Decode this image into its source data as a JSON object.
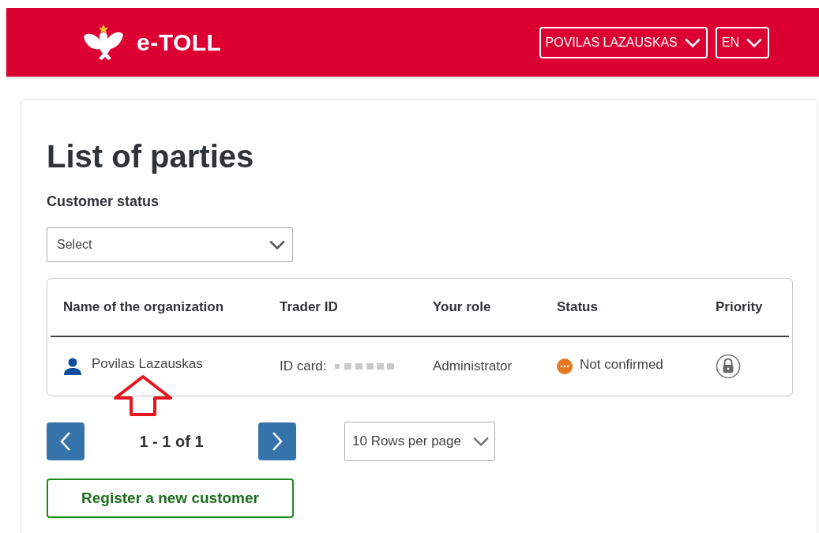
{
  "header": {
    "logo_text": "e-TOLL",
    "user_menu": "POVILAS LAZAUSKAS",
    "language": "EN"
  },
  "page": {
    "title": "List of parties",
    "filter": {
      "label": "Customer status",
      "placeholder": "Select"
    }
  },
  "table": {
    "columns": [
      "Name of the organization",
      "Trader ID",
      "Your role",
      "Status",
      "Priority"
    ],
    "rows": [
      {
        "name": "Povilas Lazauskas",
        "trader_id": "ID card:",
        "role": "Administrator",
        "status": "Not confirmed",
        "color": "#e87722"
      }
    ]
  },
  "pagination": {
    "range": "1 - 1 of 1",
    "rows_per_page": "10 Rows per page"
  },
  "actions": [
    "Register a new customer"
  ]
}
